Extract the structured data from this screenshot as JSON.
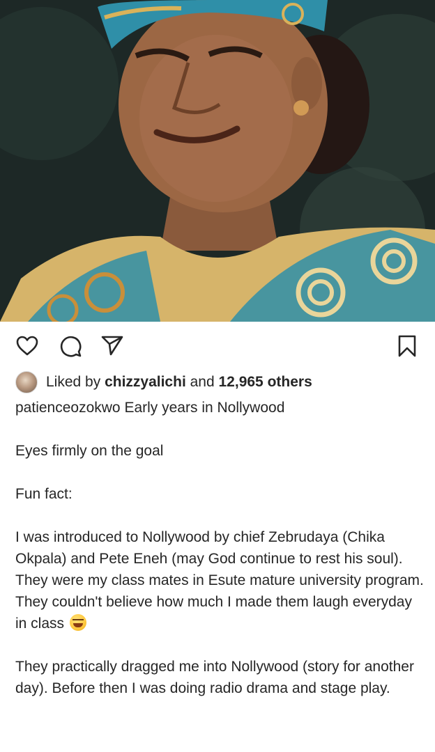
{
  "post": {
    "photo_alt": "Photo of a woman wearing a blue and gold patterned head wrap and dress",
    "liked_by_prefix": "Liked by ",
    "liked_by_user": "chizzyalichi",
    "liked_by_and": " and ",
    "liked_by_count": "12,965 others",
    "author": "patienceozokwo",
    "caption_first": "Early years in Nollywood",
    "paragraphs": [
      "Eyes firmly on the goal",
      "Fun fact:",
      "I was introduced to Nollywood by chief Zebrudaya (Chika Okpala) and Pete Eneh (may God continue to rest his soul).",
      "They were my class mates in Esute mature university program. They couldn't believe how much I made them laugh everyday in class",
      "They practically dragged me into Nollywood (story for another day). Before then I was doing radio drama and stage play."
    ]
  },
  "icons": {
    "like": "heart-icon",
    "comment": "comment-icon",
    "share": "send-icon",
    "save": "bookmark-icon",
    "emoji": "rolling-laughing-emoji"
  },
  "colors": {
    "text": "#262626",
    "wrap_blue": "#2f8fa8",
    "wrap_gold": "#d9b25a"
  }
}
